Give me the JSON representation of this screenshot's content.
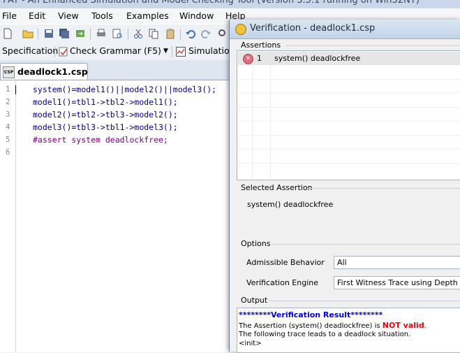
{
  "window": {
    "title": "PAT - An Enhanced Simulation and Model Checking Tool (Version 3.5.1 running on Win32NT)"
  },
  "menu": [
    "File",
    "Edit",
    "View",
    "Tools",
    "Examples",
    "Window",
    "Help"
  ],
  "toolbar2": {
    "specification_label": "Specification",
    "check_grammar_label": "Check Grammar (F5)",
    "simulation_label": "Simulation"
  },
  "document_tab": {
    "label": "deadlock1.csp",
    "icon_text": "CSP"
  },
  "editor": {
    "line_numbers": [
      "1",
      "2",
      "3",
      "4",
      "5",
      "6"
    ],
    "lines": [
      "system()=model1()||model2()||model3();",
      "model1()=tbl1->tbl2->model1();",
      "model2()=tbl2->tbl3->model2();",
      "model3()=tbl3->tbl1->model3();",
      "#assert system deadlockfree;",
      ""
    ]
  },
  "dialog": {
    "title": "Verification - deadlock1.csp",
    "assertions_label": "Assertions",
    "assertion": {
      "index": "1",
      "text": "system() deadlockfree",
      "status_icon": "x-circle-icon"
    },
    "selected_label": "Selected Assertion",
    "selected_text": "system() deadlockfree",
    "options_label": "Options",
    "admissible_label": "Admissible Behavior",
    "admissible_value": "All",
    "engine_label": "Verification Engine",
    "engine_value": "First Witness Trace using Depth First",
    "output_label": "Output",
    "output": {
      "header": "********Verification Result********",
      "line1_prefix": "The Assertion (system() deadlockfree) is ",
      "line1_bad": "NOT valid",
      "line1_suffix": ".",
      "line2": "The following trace leads to a deadlock situation.",
      "line3": "<init>"
    }
  },
  "colors": {
    "accent_blue": "#0000cc",
    "error_red": "#e00000",
    "keyword_purple": "#800080"
  }
}
